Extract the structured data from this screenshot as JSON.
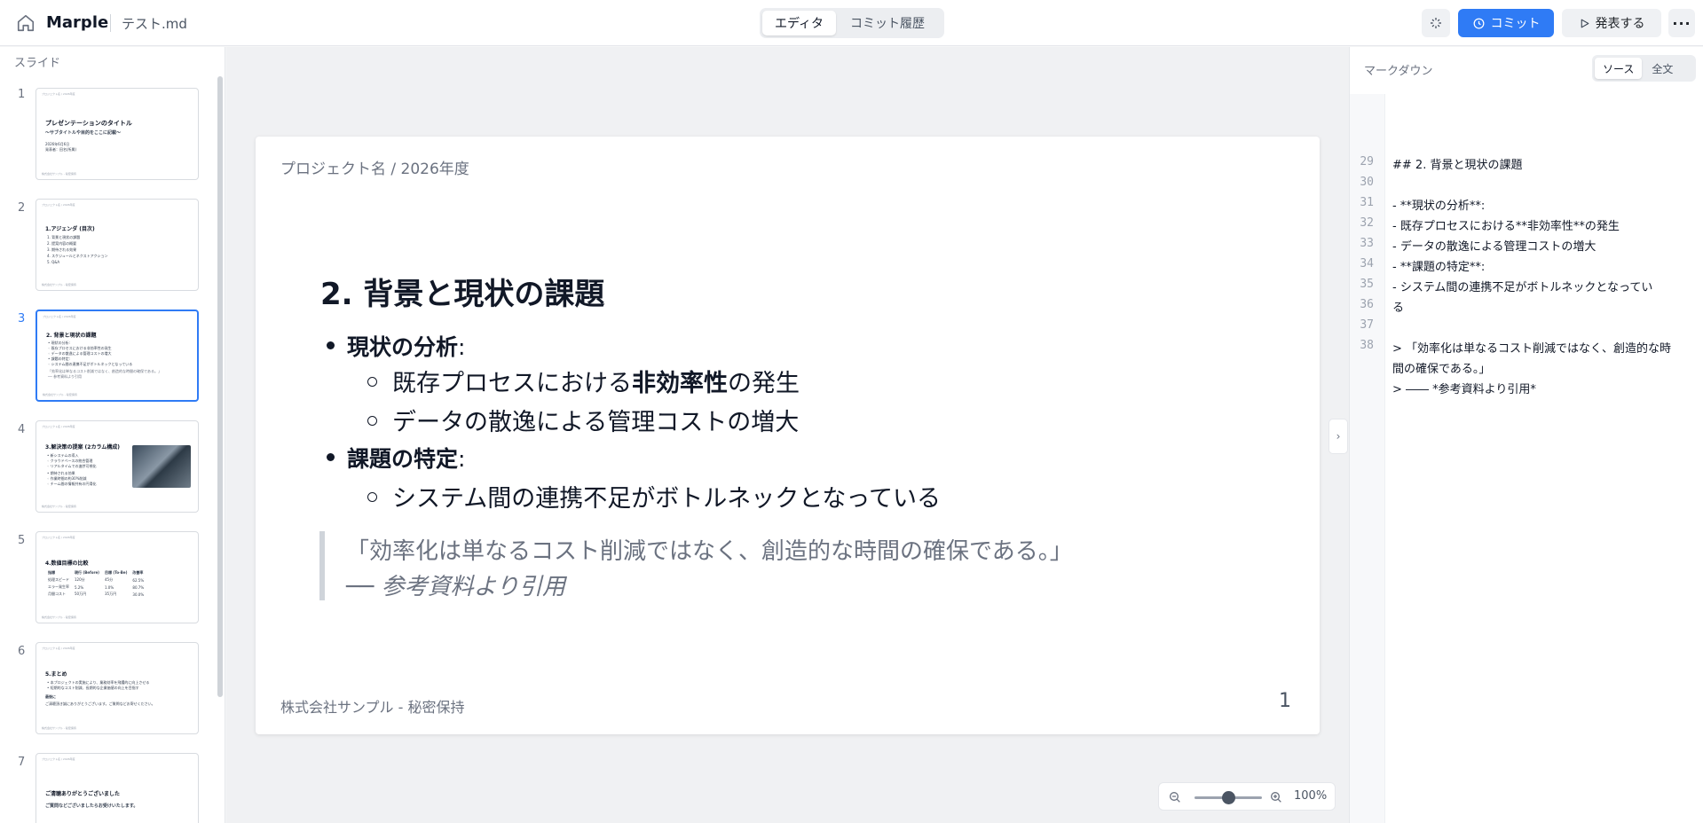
{
  "header": {
    "brand": "Marple",
    "filename": "テスト.md",
    "mode_tabs": [
      {
        "label": "エディタ",
        "active": true
      },
      {
        "label": "コミット履歴",
        "active": false
      }
    ],
    "commit_label": "コミット",
    "present_label": "発表する",
    "more_label": "···"
  },
  "sidebar": {
    "title": "スライド",
    "slides": [
      {
        "num": "1",
        "title": "プレゼンテーションのタイトル",
        "lines": [
          "〜サブタイトルや目的をここに記載〜",
          "2026年6月6日",
          "発表者：田名(所属)"
        ]
      },
      {
        "num": "2",
        "title": "1.アジェンダ (目次)",
        "lines": [
          "1. 背景と現状の課題",
          "2. 提案内容の概要",
          "3. 期待される効果",
          "4. スケジュールとネクストアクション",
          "5. Q&A"
        ]
      },
      {
        "num": "3",
        "title": "2. 背景と現状の課題",
        "lines": [
          "• 現状の分析:",
          "  ◦ 既存プロセスにおける非効率性の発生",
          "  ◦ データの散逸による管理コストの増大",
          "• 課題の特定:",
          "  ◦ システム間の連携不足がボトルネックとなっている",
          "「効率化は単なるコスト削減ではなく、創造的な時間の確保である。」",
          "── 参考資料より引用"
        ]
      },
      {
        "num": "4",
        "title": "3.解決策の提案 (2カラム構成)",
        "lines": [
          "• 新システムの導入",
          "  ◦ クラウドベースの統合管理",
          "  ◦ リアルタイムでの進捗可視化",
          "• 期待される効果",
          "  ◦ 作業時間の約30%削減",
          "  ◦ チーム間の情報共有の円滑化"
        ]
      },
      {
        "num": "5",
        "title": "4.数値目標の比較",
        "table": [
          [
            "指標",
            "現行 (Before)",
            "目標 (To-Be)",
            "改善率"
          ],
          [
            "処理スピード",
            "120分",
            "45分",
            "62.5%"
          ],
          [
            "エラー発生率",
            "5.2%",
            "1.0%",
            "80.7%"
          ],
          [
            "月間コスト",
            "50万円",
            "35万円",
            "30.0%"
          ]
        ]
      },
      {
        "num": "6",
        "title": "5.まとめ",
        "lines": [
          "• 本プロジェクトの実施により、業務効率を飛躍的に向上させる",
          "• 短期的なコスト削減、長期的な企業価値の向上を目指す",
          "最後に",
          "ご清聴頂き誠にありがとうございます。ご質問などお寄せください。"
        ]
      },
      {
        "num": "7",
        "title": "ご清聴ありがとうございました",
        "lines": [
          "ご質問などございましたらお受けいたします。"
        ]
      }
    ],
    "thumb_header": "プロジェクト名 / 2026年度",
    "thumb_footer": "株式会社サンプル - 秘密保持"
  },
  "slide": {
    "header": "プロジェクト名 / 2026年度",
    "title": "2. 背景と現状の課題",
    "bullet1": {
      "bold": "現状の分析",
      "rest": ":"
    },
    "sub1a": {
      "pre": "既存プロセスにおける",
      "bold": "非効率性",
      "post": "の発生"
    },
    "sub1b": "データの散逸による管理コストの増大",
    "bullet2": {
      "bold": "課題の特定",
      "rest": ":"
    },
    "sub2a": "システム間の連携不足がボトルネックとなっている",
    "quote_line1": "「効率化は単なるコスト削減ではなく、創造的な時間の確保である。」",
    "quote_line2": "── 参考資料より引用",
    "footer": "株式会社サンプル - 秘密保持",
    "page_number": "1"
  },
  "zoom": {
    "label": "100%",
    "level": 0.5
  },
  "markdown_panel": {
    "title": "マークダウン",
    "tabs": [
      {
        "label": "ソース",
        "active": true
      },
      {
        "label": "全文",
        "active": false
      }
    ],
    "line_numbers": [
      "29",
      "30",
      "31",
      "32",
      "33",
      "34",
      "35",
      "36",
      "37",
      "38"
    ],
    "lines": [
      "## 2. 背景と現状の課題",
      "",
      "- **現状の分析**:",
      "  - 既存プロセスにおける**非効率性**の発生",
      "  - データの散逸による管理コストの増大",
      "- **課題の特定**:",
      "  - システム間の連携不足がボトルネックとなってい",
      "る",
      "",
      "> 「効率化は単なるコスト削減ではなく、創造的な時",
      "間の確保である。」",
      "> ―― *参考資料より引用*"
    ]
  },
  "colors": {
    "accent": "#2f7bf5"
  }
}
